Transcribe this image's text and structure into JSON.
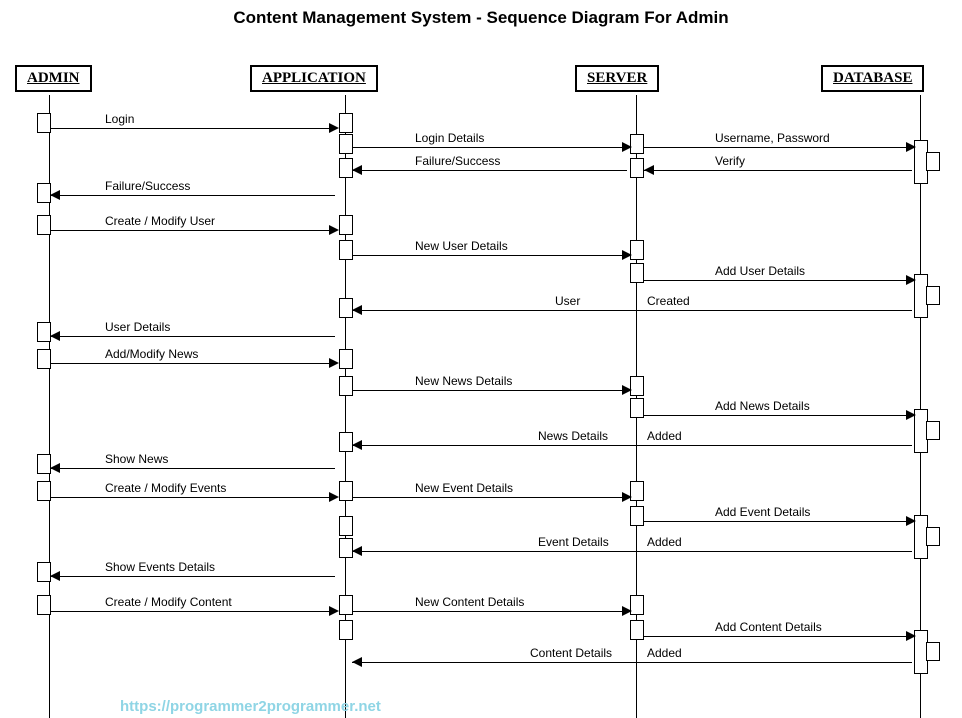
{
  "title": "Content Management System - Sequence Diagram For Admin",
  "watermark": "https://programmer2programmer.net",
  "participants": {
    "admin": "ADMIN",
    "application": "APPLICATION",
    "server": "SERVER",
    "database": "DATABASE"
  },
  "messages": {
    "m1": "Login",
    "m2": "Login Details",
    "m3": "Username, Password",
    "m4": "Verify",
    "m5": "Failure/Success",
    "m6": "Failure/Success",
    "m7": "Create / Modify User",
    "m8": "New User Details",
    "m9": "Add User Details",
    "m10a": "User",
    "m10b": "Created",
    "m11": "User Details",
    "m12": "Add/Modify News",
    "m13": "New News Details",
    "m14": "Add News Details",
    "m15a": "News Details",
    "m15b": "Added",
    "m16": "Show News",
    "m17": "Create / Modify Events",
    "m18": "New Event Details",
    "m19": "Add Event Details",
    "m20a": "Event Details",
    "m20b": "Added",
    "m21": "Show Events Details",
    "m22": "Create / Modify Content",
    "m23": "New Content Details",
    "m24": "Add Content Details",
    "m25a": "Content Details",
    "m25b": "Added"
  }
}
